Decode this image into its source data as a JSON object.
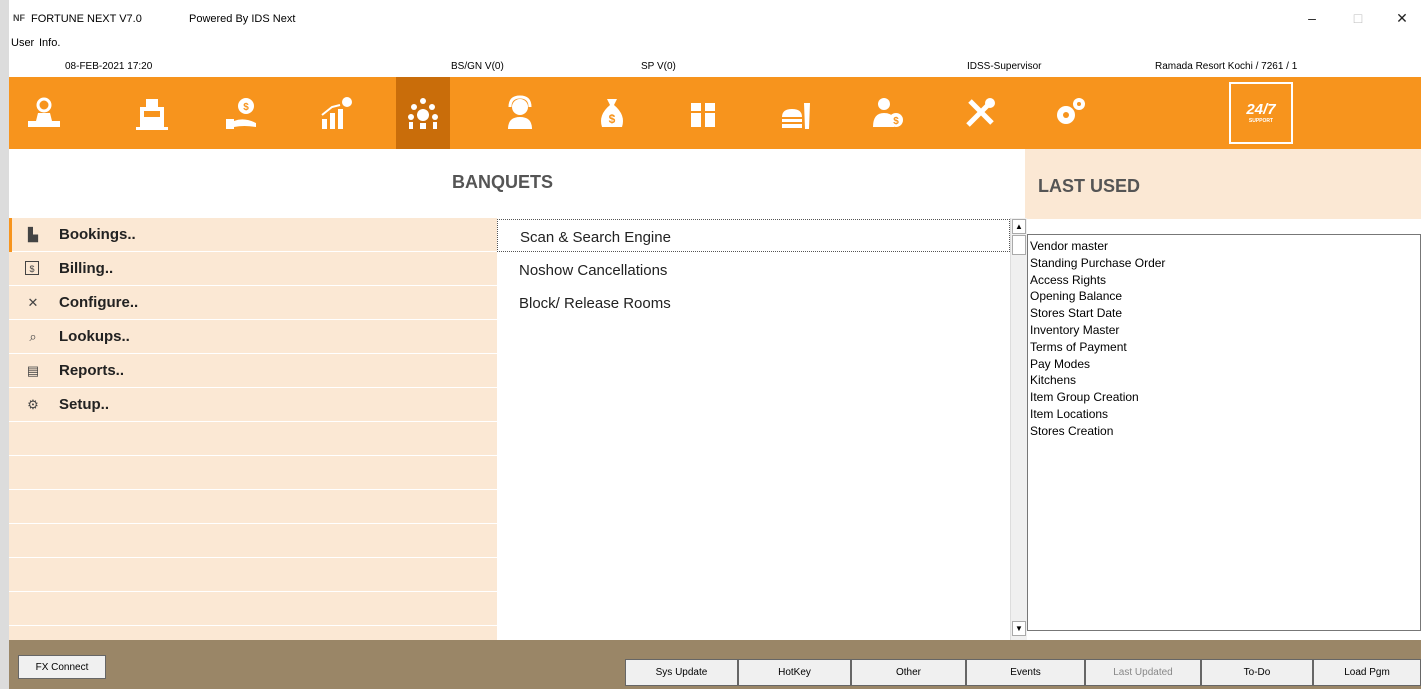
{
  "window": {
    "app_icon": "NF",
    "title": "FORTUNE NEXT  V7.0",
    "powered_by": "Powered By IDS Next",
    "minimize": "–",
    "maximize": "□",
    "close": "✕"
  },
  "menubar": {
    "user": "User",
    "info": "Info."
  },
  "status": {
    "datetime": "08-FEB-2021 17:20",
    "bs": "BS/GN V(0)",
    "sp": "SP V(0)",
    "user": "IDSS-Supervisor",
    "hotel": "Ramada Resort Kochi / 7261 / 1"
  },
  "toolbar": {
    "icons": [
      "front-office-icon",
      "pos-register-icon",
      "finance-icon",
      "reports-chart-icon",
      "banquets-icon",
      "crm-headset-icon",
      "money-bag-icon",
      "inventory-boxes-icon",
      "food-beverage-icon",
      "hr-payroll-icon",
      "tools-icon",
      "settings-gears-icon"
    ],
    "active_index": 4,
    "support_label": "24/7",
    "support_sub": "SUPPORT"
  },
  "module": {
    "title": "BANQUETS"
  },
  "left_menu": [
    {
      "label": "Bookings..",
      "icon": "bookings-icon",
      "glyph": "▙"
    },
    {
      "label": "Billing..",
      "icon": "billing-icon",
      "glyph": "$"
    },
    {
      "label": "Configure..",
      "icon": "configure-icon",
      "glyph": "✕"
    },
    {
      "label": "Lookups..",
      "icon": "lookups-icon",
      "glyph": "⌕"
    },
    {
      "label": "Reports..",
      "icon": "reports-icon",
      "glyph": "▤"
    },
    {
      "label": "Setup..",
      "icon": "setup-icon",
      "glyph": "⚙"
    }
  ],
  "sub_menu": [
    {
      "label": "Scan & Search Engine"
    },
    {
      "label": "Noshow Cancellations"
    },
    {
      "label": "Block/ Release Rooms"
    }
  ],
  "last_used": {
    "title": "LAST USED",
    "items": [
      "Vendor master",
      "Standing Purchase Order",
      "Access Rights",
      "Opening Balance",
      "Stores Start Date",
      "Inventory Master",
      "Terms of Payment",
      "Pay Modes",
      "Kitchens",
      "Item Group Creation",
      "Item Locations",
      "Stores Creation"
    ]
  },
  "bottom": {
    "fx_connect": "FX Connect",
    "buttons": [
      {
        "label": "Sys Update",
        "disabled": false
      },
      {
        "label": "HotKey",
        "disabled": false
      },
      {
        "label": "Other",
        "disabled": false
      },
      {
        "label": "Events",
        "disabled": false
      },
      {
        "label": "Last Updated",
        "disabled": true
      },
      {
        "label": "To-Do",
        "disabled": false
      },
      {
        "label": "Load Pgm",
        "disabled": false
      }
    ]
  },
  "colors": {
    "accent": "#f7941d",
    "accent_dark": "#c96d0a",
    "panel": "#fbe8d4",
    "bottom_bar": "#9a8667"
  }
}
